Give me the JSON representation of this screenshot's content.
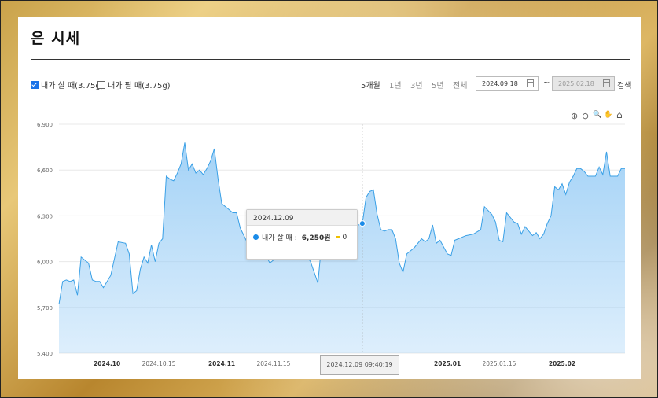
{
  "page": {
    "title": "은 시세"
  },
  "controls": {
    "buy_label": "내가 살 때(3.75g)",
    "sell_label": "내가 팔 때(3.75g)",
    "periods": [
      "5개월",
      "1년",
      "3년",
      "5년",
      "전체"
    ],
    "active_period": "5개월",
    "start_date": "2024.09.18",
    "end_date": "2025.02.18",
    "tilde": "~",
    "search_label": "검색"
  },
  "toolbar": {
    "icons": [
      "zoom-in-icon",
      "zoom-out-icon",
      "magnify-icon",
      "pan-hand-icon",
      "home-icon"
    ],
    "glyphs": [
      "⊕",
      "⊖",
      "🔍",
      "✋",
      "⌂"
    ]
  },
  "tooltip": {
    "date": "2024.12.09",
    "series_label": "내가 살 때 :",
    "value": "6,250원",
    "change": "0"
  },
  "crosshair_label": "2024.12.09 09:40:19",
  "chart_data": {
    "type": "area",
    "title": "",
    "xlabel": "",
    "ylabel": "",
    "ylim": [
      5400,
      6900
    ],
    "yticks": [
      5400,
      5700,
      6000,
      6300,
      6600,
      6900
    ],
    "ytick_labels": [
      "5,400",
      "5,700",
      "6,000",
      "6,300",
      "6,600",
      "6,900"
    ],
    "xlim": [
      "2024-09-18",
      "2025-02-18"
    ],
    "xticks": [
      {
        "date": "2024-10-01",
        "label": "2024.10",
        "bold": true
      },
      {
        "date": "2024-10-15",
        "label": "2024.10.15",
        "bold": false
      },
      {
        "date": "2024-11-01",
        "label": "2024.11",
        "bold": true
      },
      {
        "date": "2024-11-15",
        "label": "2024.11.15",
        "bold": false
      },
      {
        "date": "2025-01-01",
        "label": "2025.01",
        "bold": true
      },
      {
        "date": "2025-01-15",
        "label": "2025.01.15",
        "bold": false
      },
      {
        "date": "2025-02-01",
        "label": "2025.02",
        "bold": true
      }
    ],
    "grid": true,
    "colors": {
      "line": "#3aa0e6",
      "fill": "#9fd0f6"
    },
    "series": [
      {
        "name": "내가 살 때",
        "points": [
          [
            "2024-09-18",
            5720
          ],
          [
            "2024-09-19",
            5870
          ],
          [
            "2024-09-20",
            5880
          ],
          [
            "2024-09-21",
            5870
          ],
          [
            "2024-09-22",
            5880
          ],
          [
            "2024-09-23",
            5780
          ],
          [
            "2024-09-24",
            6030
          ],
          [
            "2024-09-25",
            6010
          ],
          [
            "2024-09-26",
            5990
          ],
          [
            "2024-09-27",
            5880
          ],
          [
            "2024-09-28",
            5870
          ],
          [
            "2024-09-29",
            5870
          ],
          [
            "2024-09-30",
            5830
          ],
          [
            "2024-10-02",
            5910
          ],
          [
            "2024-10-04",
            6130
          ],
          [
            "2024-10-06",
            6120
          ],
          [
            "2024-10-07",
            6050
          ],
          [
            "2024-10-08",
            5790
          ],
          [
            "2024-10-09",
            5810
          ],
          [
            "2024-10-10",
            5950
          ],
          [
            "2024-10-11",
            6030
          ],
          [
            "2024-10-12",
            5990
          ],
          [
            "2024-10-13",
            6110
          ],
          [
            "2024-10-14",
            6000
          ],
          [
            "2024-10-15",
            6120
          ],
          [
            "2024-10-16",
            6150
          ],
          [
            "2024-10-17",
            6560
          ],
          [
            "2024-10-18",
            6540
          ],
          [
            "2024-10-19",
            6530
          ],
          [
            "2024-10-20",
            6580
          ],
          [
            "2024-10-21",
            6640
          ],
          [
            "2024-10-22",
            6780
          ],
          [
            "2024-10-23",
            6600
          ],
          [
            "2024-10-24",
            6640
          ],
          [
            "2024-10-25",
            6580
          ],
          [
            "2024-10-26",
            6600
          ],
          [
            "2024-10-27",
            6570
          ],
          [
            "2024-10-28",
            6610
          ],
          [
            "2024-10-29",
            6660
          ],
          [
            "2024-10-30",
            6740
          ],
          [
            "2024-10-31",
            6540
          ],
          [
            "2024-11-01",
            6380
          ],
          [
            "2024-11-02",
            6360
          ],
          [
            "2024-11-03",
            6340
          ],
          [
            "2024-11-04",
            6320
          ],
          [
            "2024-11-05",
            6320
          ],
          [
            "2024-11-06",
            6220
          ],
          [
            "2024-11-07",
            6170
          ],
          [
            "2024-11-08",
            6120
          ],
          [
            "2024-11-09",
            6110
          ],
          [
            "2024-11-11",
            6070
          ],
          [
            "2024-11-13",
            6040
          ],
          [
            "2024-11-14",
            5990
          ],
          [
            "2024-11-15",
            6010
          ],
          [
            "2024-11-16",
            6040
          ],
          [
            "2024-11-17",
            6030
          ],
          [
            "2024-11-18",
            6120
          ],
          [
            "2024-11-19",
            6150
          ],
          [
            "2024-11-20",
            6130
          ],
          [
            "2024-11-21",
            6110
          ],
          [
            "2024-11-22",
            6100
          ],
          [
            "2024-11-25",
            6000
          ],
          [
            "2024-11-27",
            5860
          ],
          [
            "2024-11-28",
            6120
          ],
          [
            "2024-11-30",
            6010
          ],
          [
            "2024-12-02",
            6030
          ],
          [
            "2024-12-03",
            6080
          ],
          [
            "2024-12-04",
            6090
          ],
          [
            "2024-12-05",
            6150
          ],
          [
            "2024-12-06",
            6200
          ],
          [
            "2024-12-07",
            6240
          ],
          [
            "2024-12-08",
            6240
          ],
          [
            "2024-12-09",
            6250
          ],
          [
            "2024-12-10",
            6420
          ],
          [
            "2024-12-11",
            6460
          ],
          [
            "2024-12-12",
            6470
          ],
          [
            "2024-12-13",
            6310
          ],
          [
            "2024-12-14",
            6210
          ],
          [
            "2024-12-15",
            6200
          ],
          [
            "2024-12-16",
            6210
          ],
          [
            "2024-12-17",
            6210
          ],
          [
            "2024-12-18",
            6150
          ],
          [
            "2024-12-19",
            5990
          ],
          [
            "2024-12-20",
            5930
          ],
          [
            "2024-12-21",
            6050
          ],
          [
            "2024-12-22",
            6070
          ],
          [
            "2024-12-23",
            6090
          ],
          [
            "2024-12-24",
            6120
          ],
          [
            "2024-12-25",
            6150
          ],
          [
            "2024-12-26",
            6130
          ],
          [
            "2024-12-27",
            6150
          ],
          [
            "2024-12-28",
            6240
          ],
          [
            "2024-12-29",
            6120
          ],
          [
            "2024-12-30",
            6140
          ],
          [
            "2025-01-01",
            6050
          ],
          [
            "2025-01-02",
            6040
          ],
          [
            "2025-01-03",
            6140
          ],
          [
            "2025-01-04",
            6150
          ],
          [
            "2025-01-06",
            6170
          ],
          [
            "2025-01-08",
            6180
          ],
          [
            "2025-01-10",
            6210
          ],
          [
            "2025-01-11",
            6360
          ],
          [
            "2025-01-13",
            6310
          ],
          [
            "2025-01-14",
            6260
          ],
          [
            "2025-01-15",
            6140
          ],
          [
            "2025-01-16",
            6130
          ],
          [
            "2025-01-17",
            6320
          ],
          [
            "2025-01-18",
            6290
          ],
          [
            "2025-01-19",
            6260
          ],
          [
            "2025-01-20",
            6250
          ],
          [
            "2025-01-21",
            6180
          ],
          [
            "2025-01-22",
            6230
          ],
          [
            "2025-01-23",
            6200
          ],
          [
            "2025-01-24",
            6170
          ],
          [
            "2025-01-25",
            6190
          ],
          [
            "2025-01-26",
            6150
          ],
          [
            "2025-01-27",
            6180
          ],
          [
            "2025-01-28",
            6250
          ],
          [
            "2025-01-29",
            6300
          ],
          [
            "2025-01-30",
            6490
          ],
          [
            "2025-01-31",
            6470
          ],
          [
            "2025-02-01",
            6510
          ],
          [
            "2025-02-02",
            6440
          ],
          [
            "2025-02-03",
            6520
          ],
          [
            "2025-02-04",
            6560
          ],
          [
            "2025-02-05",
            6610
          ],
          [
            "2025-02-06",
            6610
          ],
          [
            "2025-02-07",
            6590
          ],
          [
            "2025-02-08",
            6560
          ],
          [
            "2025-02-09",
            6560
          ],
          [
            "2025-02-10",
            6560
          ],
          [
            "2025-02-11",
            6620
          ],
          [
            "2025-02-12",
            6570
          ],
          [
            "2025-02-13",
            6720
          ],
          [
            "2025-02-14",
            6560
          ],
          [
            "2025-02-15",
            6560
          ],
          [
            "2025-02-16",
            6560
          ],
          [
            "2025-02-17",
            6610
          ],
          [
            "2025-02-18",
            6610
          ]
        ]
      }
    ],
    "highlight": {
      "date": "2024-12-09",
      "value": 6250
    }
  }
}
